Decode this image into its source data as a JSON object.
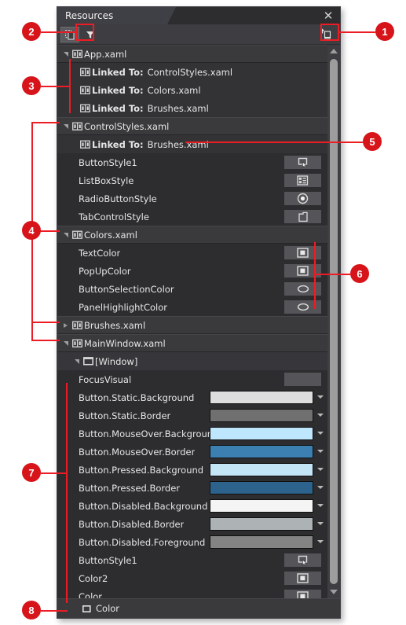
{
  "panel": {
    "tab_title": "Resources",
    "close_label": "✕",
    "toolbar": {
      "show_all_icon": "copy-pages-icon",
      "filter_icon": "funnel-filter-icon",
      "add_resource_icon": "add-resource-icon"
    },
    "statusbar": {
      "label": "Color",
      "icon": "square-outline-icon"
    }
  },
  "tree": [
    {
      "kind": "file",
      "indent": 4,
      "twisty": "down",
      "icon": "resource-dictionary-icon",
      "label": "App.xaml"
    },
    {
      "kind": "child",
      "indent": 14,
      "twisty": "none",
      "icon": "resource-dictionary-icon",
      "bold": "Linked To:",
      "label": "ControlStyles.xaml"
    },
    {
      "kind": "child",
      "indent": 14,
      "twisty": "none",
      "icon": "resource-dictionary-icon",
      "bold": "Linked To:",
      "label": "Colors.xaml"
    },
    {
      "kind": "child",
      "indent": 14,
      "twisty": "none",
      "icon": "resource-dictionary-icon",
      "bold": "Linked To:",
      "label": "Brushes.xaml"
    },
    {
      "kind": "file",
      "indent": 4,
      "twisty": "down",
      "icon": "resource-dictionary-icon",
      "label": "ControlStyles.xaml"
    },
    {
      "kind": "child",
      "indent": 14,
      "twisty": "none",
      "icon": "resource-dictionary-icon",
      "bold": "Linked To:",
      "label": "Brushes.xaml"
    },
    {
      "kind": "leaf",
      "indent": 14,
      "twisty": "none",
      "label": "ButtonStyle1",
      "swatch": "button-style-icon"
    },
    {
      "kind": "leaf",
      "indent": 14,
      "twisty": "none",
      "label": "ListBoxStyle",
      "swatch": "listbox-style-icon"
    },
    {
      "kind": "leaf",
      "indent": 14,
      "twisty": "none",
      "label": "RadioButtonStyle",
      "swatch": "radiobutton-style-icon"
    },
    {
      "kind": "leaf",
      "indent": 14,
      "twisty": "none",
      "label": "TabControlStyle",
      "swatch": "tabcontrol-style-icon"
    },
    {
      "kind": "file",
      "indent": 4,
      "twisty": "down",
      "icon": "resource-dictionary-icon",
      "label": "Colors.xaml"
    },
    {
      "kind": "leaf",
      "indent": 14,
      "twisty": "none",
      "label": "TextColor",
      "swatch": "color-square-icon"
    },
    {
      "kind": "leaf",
      "indent": 14,
      "twisty": "none",
      "label": "PopUpColor",
      "swatch": "color-square-icon"
    },
    {
      "kind": "leaf",
      "indent": 14,
      "twisty": "none",
      "label": "ButtonSelectionColor",
      "swatch": "color-ellipse-icon"
    },
    {
      "kind": "leaf",
      "indent": 14,
      "twisty": "none",
      "label": "PanelHighlightColor",
      "swatch": "color-ellipse-icon"
    },
    {
      "kind": "file",
      "indent": 4,
      "twisty": "right",
      "icon": "resource-dictionary-icon",
      "label": "Brushes.xaml"
    },
    {
      "kind": "file",
      "indent": 4,
      "twisty": "down",
      "icon": "resource-dictionary-icon",
      "label": "MainWindow.xaml"
    },
    {
      "kind": "sub",
      "indent": 18,
      "twisty": "down",
      "icon": "window-icon",
      "label": "[Window]"
    },
    {
      "kind": "leaf",
      "indent": 14,
      "twisty": "none",
      "label": "FocusVisual",
      "swatch": "blank-swatch-icon"
    },
    {
      "kind": "leaf",
      "indent": 14,
      "twisty": "none",
      "label": "Button.Static.Background",
      "color": "#dedede"
    },
    {
      "kind": "leaf",
      "indent": 14,
      "twisty": "none",
      "label": "Button.Static.Border",
      "color": "#707070"
    },
    {
      "kind": "leaf",
      "indent": 14,
      "twisty": "none",
      "label": "Button.MouseOver.Background",
      "color": "#bee6fd"
    },
    {
      "kind": "leaf",
      "indent": 14,
      "twisty": "none",
      "label": "Button.MouseOver.Border",
      "color": "#3c7fb1"
    },
    {
      "kind": "leaf",
      "indent": 14,
      "twisty": "none",
      "label": "Button.Pressed.Background",
      "color": "#c4e5f6"
    },
    {
      "kind": "leaf",
      "indent": 14,
      "twisty": "none",
      "label": "Button.Pressed.Border",
      "color": "#2c628b"
    },
    {
      "kind": "leaf",
      "indent": 14,
      "twisty": "none",
      "label": "Button.Disabled.Background",
      "color": "#f4f4f4"
    },
    {
      "kind": "leaf",
      "indent": 14,
      "twisty": "none",
      "label": "Button.Disabled.Border",
      "color": "#adb2b5"
    },
    {
      "kind": "leaf",
      "indent": 14,
      "twisty": "none",
      "label": "Button.Disabled.Foreground",
      "color": "#838383"
    },
    {
      "kind": "leaf",
      "indent": 14,
      "twisty": "none",
      "label": "ButtonStyle1",
      "swatch": "button-style-icon"
    },
    {
      "kind": "leaf",
      "indent": 14,
      "twisty": "none",
      "label": "Color2",
      "swatch": "color-square-icon"
    },
    {
      "kind": "leaf",
      "indent": 14,
      "twisty": "none",
      "label": "Color",
      "swatch": "color-square-icon"
    }
  ],
  "callouts": [
    {
      "n": "1"
    },
    {
      "n": "2"
    },
    {
      "n": "3"
    },
    {
      "n": "4"
    },
    {
      "n": "5"
    },
    {
      "n": "6"
    },
    {
      "n": "7"
    },
    {
      "n": "8"
    }
  ],
  "colors": {
    "accent_red": "#ed1c24",
    "callout_red": "#d7141a",
    "panel_bg": "#2d2d30",
    "row_file_bg": "#3a3a3d",
    "text": "#e6e6e6"
  }
}
